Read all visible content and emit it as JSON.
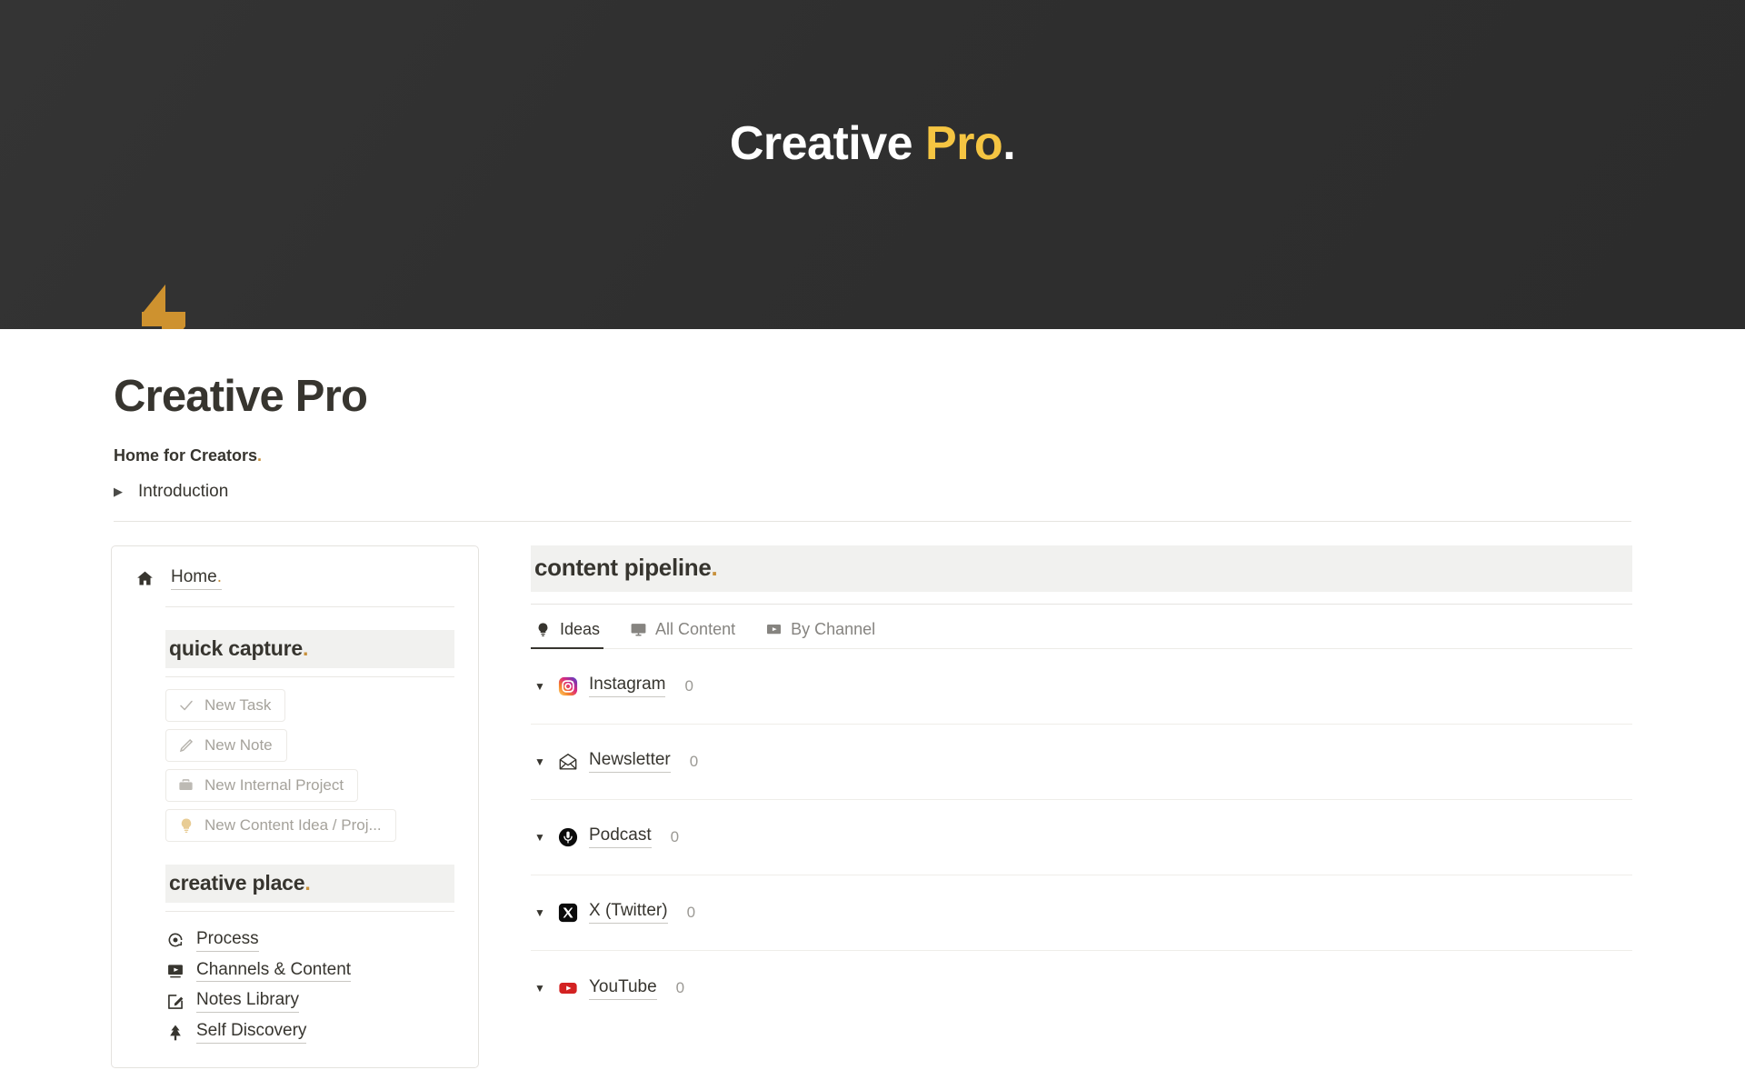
{
  "banner": {
    "title_main": "Creative ",
    "title_accent": "Pro",
    "title_dot": "."
  },
  "page": {
    "icon": "lightning-bolt-icon",
    "title": "Creative Pro",
    "subtitle": "Home for Creators",
    "subtitle_dot": ".",
    "toggle": {
      "caret": "▶",
      "label": "Introduction"
    }
  },
  "sidebar": {
    "home": {
      "icon": "home-icon",
      "label": "Home",
      "dot": "."
    },
    "quick_capture": {
      "heading": "quick capture",
      "heading_dot": ".",
      "buttons": [
        {
          "icon": "check-icon",
          "label": "New Task"
        },
        {
          "icon": "pencil-icon",
          "label": "New Note"
        },
        {
          "icon": "briefcase-icon",
          "label": "New Internal Project"
        },
        {
          "icon": "lightbulb-icon",
          "label": "New Content Idea / Proj..."
        }
      ]
    },
    "creative_place": {
      "heading": "creative place",
      "heading_dot": ".",
      "items": [
        {
          "icon": "process-icon",
          "label": "Process"
        },
        {
          "icon": "video-icon",
          "label": "Channels & Content"
        },
        {
          "icon": "note-edit-icon",
          "label": "Notes Library"
        },
        {
          "icon": "tree-icon",
          "label": "Self Discovery"
        }
      ]
    }
  },
  "main": {
    "heading": "content pipeline",
    "heading_dot": ".",
    "tabs": [
      {
        "icon": "lightbulb-icon",
        "label": "Ideas",
        "active": true
      },
      {
        "icon": "monitor-icon",
        "label": "All Content",
        "active": false
      },
      {
        "icon": "video-icon",
        "label": "By Channel",
        "active": false
      }
    ],
    "channels": [
      {
        "caret": "▼",
        "icon": "instagram-icon",
        "name": "Instagram",
        "count": "0"
      },
      {
        "caret": "▼",
        "icon": "newsletter-icon",
        "name": "Newsletter",
        "count": "0"
      },
      {
        "caret": "▼",
        "icon": "podcast-icon",
        "name": "Podcast",
        "count": "0"
      },
      {
        "caret": "▼",
        "icon": "x-twitter-icon",
        "name": "X (Twitter)",
        "count": "0"
      },
      {
        "caret": "▼",
        "icon": "youtube-icon",
        "name": "YouTube",
        "count": "0"
      }
    ]
  },
  "colors": {
    "banner_bg": "#2F2F2F",
    "accent_gold": "#F5C542",
    "dot_gold": "#C8913C",
    "bolt_gold": "#CE922F",
    "text": "#37352F",
    "muted": "#9B9994",
    "section_bg": "#F1F1EF"
  }
}
